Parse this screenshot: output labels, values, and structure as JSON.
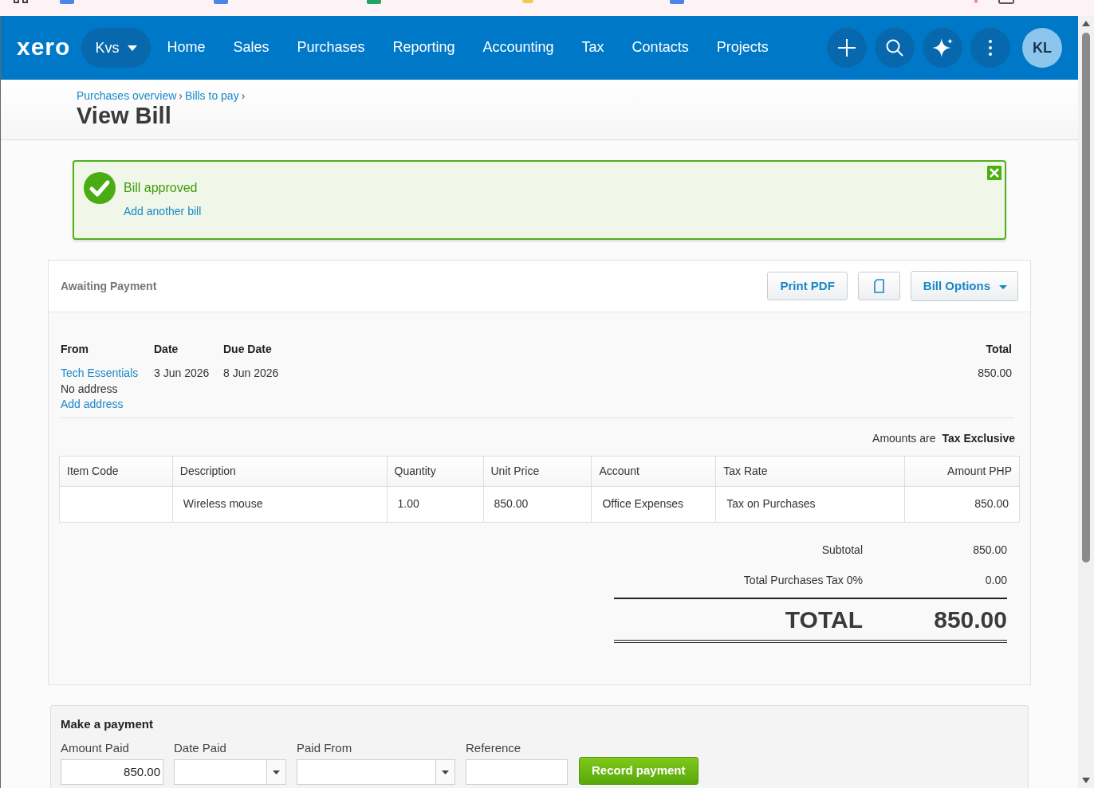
{
  "nav": {
    "logo": "xero",
    "organisation": "Kvs",
    "items": [
      {
        "label": "Home",
        "selected": false
      },
      {
        "label": "Sales",
        "selected": false
      },
      {
        "label": "Purchases",
        "selected": false
      },
      {
        "label": "Reporting",
        "selected": false
      },
      {
        "label": "Accounting",
        "selected": false
      },
      {
        "label": "Tax",
        "selected": false
      },
      {
        "label": "Contacts",
        "selected": false
      },
      {
        "label": "Projects",
        "selected": false
      }
    ],
    "avatar": "KL"
  },
  "breadcrumb": [
    {
      "label": "Purchases overview",
      "separator": "›"
    },
    {
      "label": "Bills to pay",
      "separator": "›"
    }
  ],
  "page_title": "View Bill",
  "notification": {
    "message": "Bill approved",
    "link": "Add another bill"
  },
  "bill": {
    "status": "Awaiting Payment",
    "actions": [
      {
        "kind": "text",
        "label": "Print PDF"
      },
      {
        "kind": "icon"
      },
      {
        "kind": "dropdown",
        "label": "Bill Options"
      }
    ],
    "from": {
      "label": "From",
      "contact": "Tech Essentials",
      "address": "No address",
      "add_address": "Add address"
    },
    "date": {
      "label": "Date",
      "value": "3 Jun 2026"
    },
    "due_date": {
      "label": "Due Date",
      "value": "8 Jun 2026"
    },
    "total": {
      "label": "Total",
      "value": "850.00"
    },
    "amounts_note": {
      "label": "Amounts are",
      "value": "Tax Exclusive"
    },
    "table": {
      "columns": [
        "Item Code",
        "Description",
        "Quantity",
        "Unit Price",
        "Account",
        "Tax Rate",
        "Amount PHP"
      ],
      "rows": [
        [
          null,
          "Wireless mouse",
          "1.00",
          "850.00",
          "Office Expenses",
          "Tax on Purchases",
          "850.00"
        ]
      ]
    },
    "totals": [
      {
        "label": "Subtotal",
        "value": "850.00"
      },
      {
        "label": "Total Purchases Tax 0%",
        "value": "0.00"
      }
    ],
    "grand_total": {
      "label": "TOTAL",
      "value": "850.00"
    }
  },
  "payment": {
    "title": "Make a payment",
    "fields": [
      {
        "kind": "amount",
        "label": "Amount Paid",
        "value": "850.00"
      },
      {
        "kind": "dropdown",
        "label": "Date Paid"
      },
      {
        "kind": "dropdown",
        "label": "Paid From"
      },
      {
        "kind": "text",
        "label": "Reference"
      }
    ],
    "button": "Record payment"
  }
}
